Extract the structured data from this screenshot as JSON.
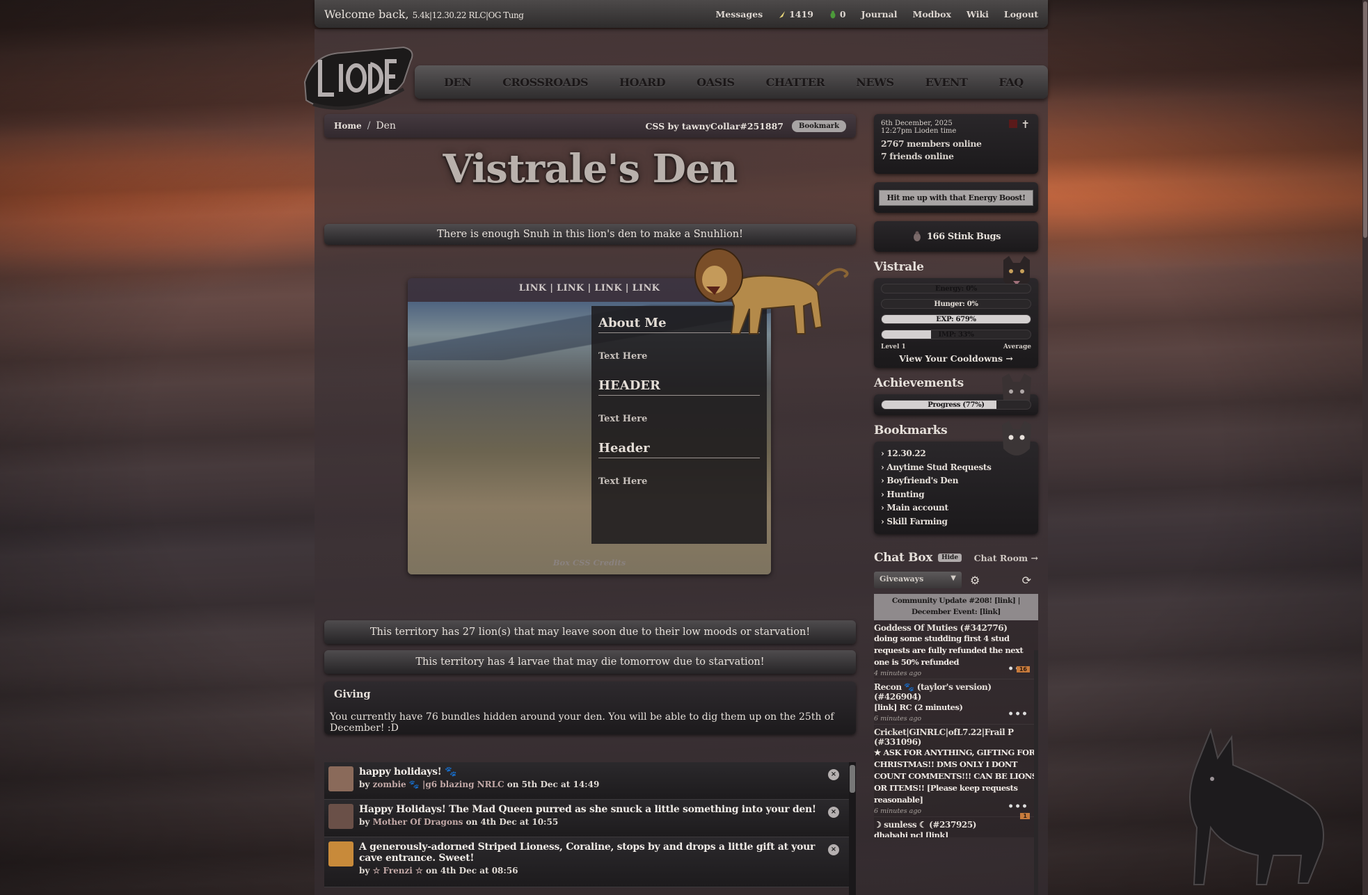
{
  "topbar": {
    "welcome": "Welcome back,",
    "welcome_sub": "5.4k|12.30.22 RLC|OG Tung",
    "messages": "Messages",
    "currency_amount": "1419",
    "mail_count": "0",
    "journal": "Journal",
    "modbox": "Modbox",
    "wiki": "Wiki",
    "logout": "Logout"
  },
  "mainnav": [
    "DEN",
    "CROSSROADS",
    "HOARD",
    "OASIS",
    "CHATTER",
    "NEWS",
    "EVENT",
    "FAQ"
  ],
  "breadcrumb": {
    "home": "Home",
    "sep": "/",
    "current": "Den",
    "css_credit": "CSS by tawnyCollar#251887",
    "bookmark": "Bookmark"
  },
  "den": {
    "title": "Vistrale's Den",
    "snuh_msg": "There is enough Snuh in this lion's den to make a Snuhlion!",
    "links": "LINK | LINK | LINK | LINK",
    "about_me": "About Me",
    "text1": "Text Here",
    "header1": "HEADER",
    "text2": "Text Here",
    "header2": "Header",
    "text3": "Text Here",
    "box_credits": "Box CSS Credits",
    "territory_lions": "This territory has 27 lion(s) that may leave soon due to their low moods or starvation!",
    "territory_larvae": "This territory has 4 larvae that may die tomorrow due to starvation!",
    "giving_title": "Giving",
    "giving_text": "You currently have 76 bundles hidden around your den. You will be able to dig them up on the 25th of December! :D"
  },
  "feed": [
    {
      "title": "happy holidays! 🐾",
      "by": "by",
      "user": "zombie 🐾 |g6 blazing NRLC",
      "when": "on 5th Dec at 14:49",
      "avatar_color": "#8a6a5a"
    },
    {
      "title": "Happy Holidays! The Mad Queen purred as she snuck a little something into your den!",
      "by": "by",
      "user": "Mother Of Dragons",
      "when": "on 4th Dec at 10:55",
      "avatar_color": "#6a5048"
    },
    {
      "title": "A generously-adorned Striped Lioness, Coraline, stops by and drops a little gift at your cave entrance. Sweet!",
      "by": "by",
      "user": "☆ Frenzi ☆",
      "when": "on 4th Dec at 08:56",
      "avatar_color": "#c88a3a"
    }
  ],
  "sidebar": {
    "date": "6th December, 2025",
    "time": "12:27pm Lioden time",
    "members_online": "2767 members online",
    "friends_online": "7 friends online",
    "energy_boost": "Hit me up with that Energy Boost!",
    "stink_bugs": "166 Stink Bugs",
    "lion_name": "Vistrale",
    "stats": [
      {
        "label": "Energy: 0%",
        "value": 0
      },
      {
        "label": "Hunger: 0%",
        "value": 0
      },
      {
        "label": "EXP: 679%",
        "value": 100
      },
      {
        "label": "IMP: 33%",
        "value": 33
      }
    ],
    "level": "Level 1",
    "average": "Average",
    "cooldowns": "View Your Cooldowns →",
    "achievements_title": "Achievements",
    "achievements_progress": {
      "label": "Progress (77%)",
      "value": 77
    },
    "bookmarks_title": "Bookmarks",
    "bookmarks": [
      "› 12.30.22",
      "› Anytime Stud Requests",
      "› Boyfriend's Den",
      "› Hunting",
      "› Main account",
      "› Skill Farming"
    ],
    "chat_title": "Chat Box",
    "chat_hide": "Hide",
    "chat_room": "Chat Room →",
    "chat_channel": "Giveaways",
    "community_update": "Community Update #208! [link] | December Event: [link]",
    "messages": [
      {
        "name": "Goddess Of Muties (#342776)",
        "body": "doing some studding first 4 stud requests are fully refunded the next one is 50% refunded",
        "time": "4 minutes ago",
        "count": "16"
      },
      {
        "name": "Recon 🐾 (taylor's version) (#426904)",
        "body": "[link] RC (2 minutes)",
        "time": "6 minutes ago",
        "count": ""
      },
      {
        "name": "Cricket|GINRLC|ofL7.22|Frail P (#331096)",
        "body": "★ ASK FOR ANYTHING, GIFTING FOR CHRISTMAS!! DMS ONLY I DONT COUNT COMMENTS!!! CAN BE LIONS OR ITEMS!! [Please keep requests reasonable]",
        "time": "6 minutes ago",
        "count": "1"
      },
      {
        "name": "☽ sunless ☾ (#237925)",
        "body": "dhabahi ncl [link]",
        "time": "",
        "count": ""
      }
    ]
  },
  "colors": {
    "accent": "#b9b1ac",
    "panel": "#1c1a1c",
    "chat_badge": "#c87b3c"
  }
}
